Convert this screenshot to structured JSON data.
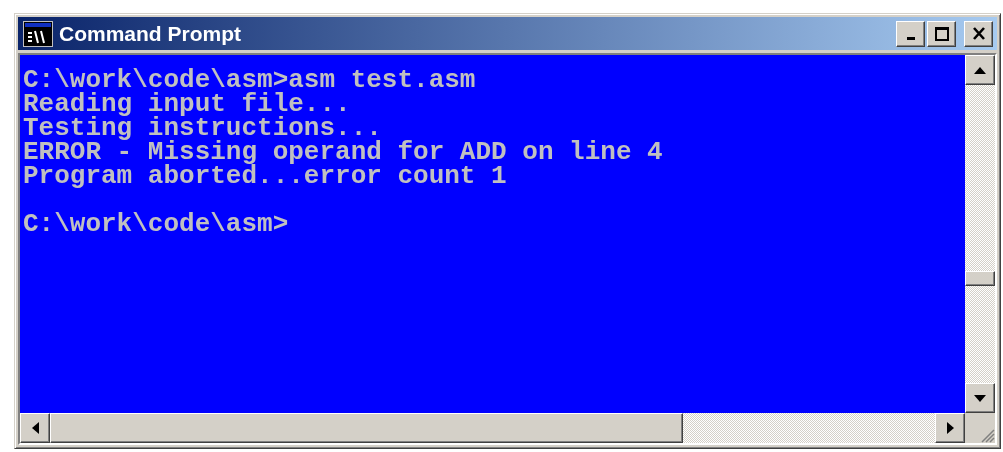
{
  "window": {
    "title": "Command Prompt"
  },
  "console": {
    "blocks": [
      [
        "C:\\work\\code\\asm>asm test.asm",
        "Reading input file...",
        "Testing instructions...",
        "ERROR - Missing operand for ADD on line 4",
        "Program aborted...error count 1"
      ],
      [
        "C:\\work\\code\\asm>"
      ]
    ]
  }
}
